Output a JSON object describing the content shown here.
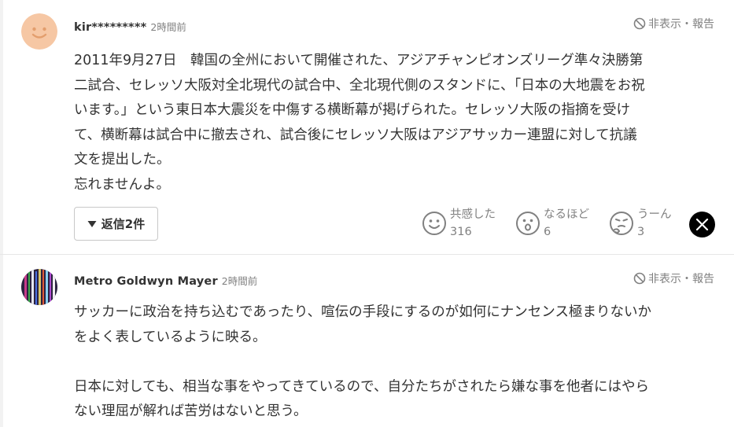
{
  "comments": [
    {
      "username": "kir*********",
      "timestamp": "2時間前",
      "report_label": "非表示・報告",
      "lines": [
        "2011年9月27日　韓国の全州において開催された、アジアチャンピオンズリーグ準々決勝第",
        "二試合、セレッソ大阪対全北現代の試合中、全北現代側のスタンドに、「日本の大地震をお祝",
        "います。」という東日本大震災を中傷する横断幕が掲げられた。セレッソ大阪の指摘を受け",
        "て、横断幕は試合中に撤去され、試合後にセレッソ大阪はアジアサッカー連盟に対して抗議",
        "文を提出した。",
        "忘れませんよ。"
      ],
      "replies_label": "返信2件",
      "reactions": [
        {
          "icon": "smile-face-icon",
          "label": "共感した",
          "count": "316"
        },
        {
          "icon": "surprised-face-icon",
          "label": "なるほど",
          "count": "6"
        },
        {
          "icon": "thinking-face-icon",
          "label": "うーん",
          "count": "3"
        }
      ],
      "share_icon": "x-logo-icon"
    },
    {
      "username": "Metro Goldwyn Mayer",
      "timestamp": "2時間前",
      "report_label": "非表示・報告",
      "lines": [
        "サッカーに政治を持ち込むであったり、喧伝の手段にするのが如何にナンセンス極まりないか",
        "をよく表しているように映る。",
        "",
        "日本に対しても、相当な事をやってきているので、自分たちがされたら嫌な事を他者にはやら",
        "ない理屈が解れば苦労はないと思う。"
      ]
    }
  ],
  "colors": {
    "text": "#333333",
    "muted": "#808080",
    "avatar_bg": "#f6c7a4",
    "avatar_face": "#e39e6d",
    "border": "#c8c8c8"
  }
}
